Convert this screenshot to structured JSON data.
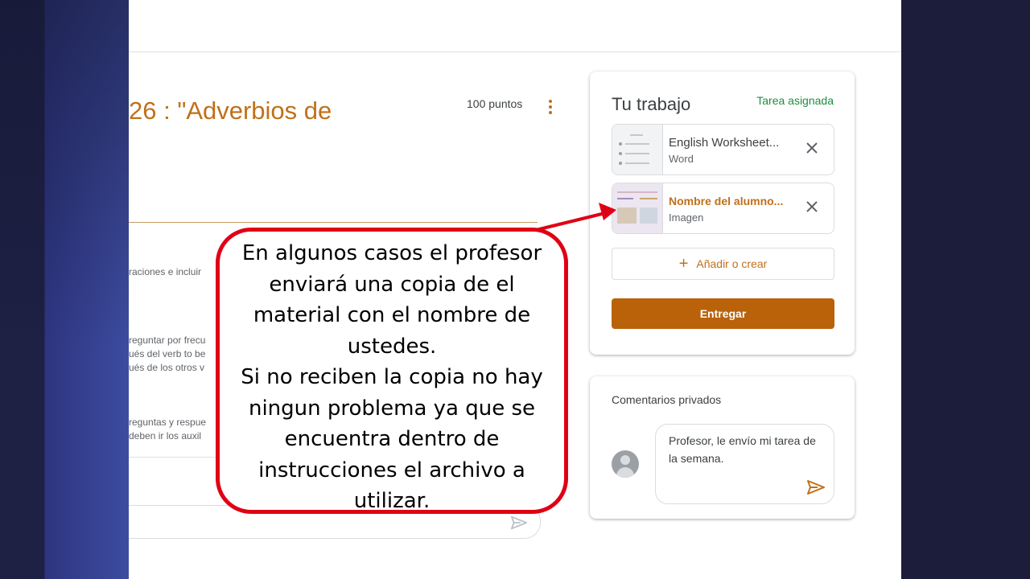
{
  "assignment": {
    "title": "26 : \"Adverbios de",
    "points": "100 puntos"
  },
  "instructions": {
    "snippets": [
      "raciones e incluir",
      "reguntar por frecu",
      "ués del verb to be",
      "ués de los otros v",
      "reguntas y respue",
      " deben ir los auxil"
    ]
  },
  "work_panel": {
    "title": "Tu trabajo",
    "status": "Tarea asignada",
    "attachments": [
      {
        "name": "English Worksheet...",
        "type": "Word"
      },
      {
        "name": "Nombre del alumno...",
        "type": "Imagen"
      }
    ],
    "add_label": "Añadir o crear",
    "submit_label": "Entregar"
  },
  "private_comments": {
    "title": "Comentarios privados",
    "text": "Profesor, le envío mi tarea de la semana."
  },
  "annotation": {
    "lines": [
      "En algunos casos el profesor",
      "enviará una copia de el",
      "material con el nombre de",
      "ustedes.",
      "Si no reciben la copia no hay",
      "ningun problema ya que se",
      "encuentra dentro de",
      "instrucciones el archivo a",
      "utilizar."
    ]
  },
  "colors": {
    "accent": "#c0701a",
    "submit": "#b9620a",
    "status": "#1e8e3e",
    "callout_border": "#e00015"
  }
}
